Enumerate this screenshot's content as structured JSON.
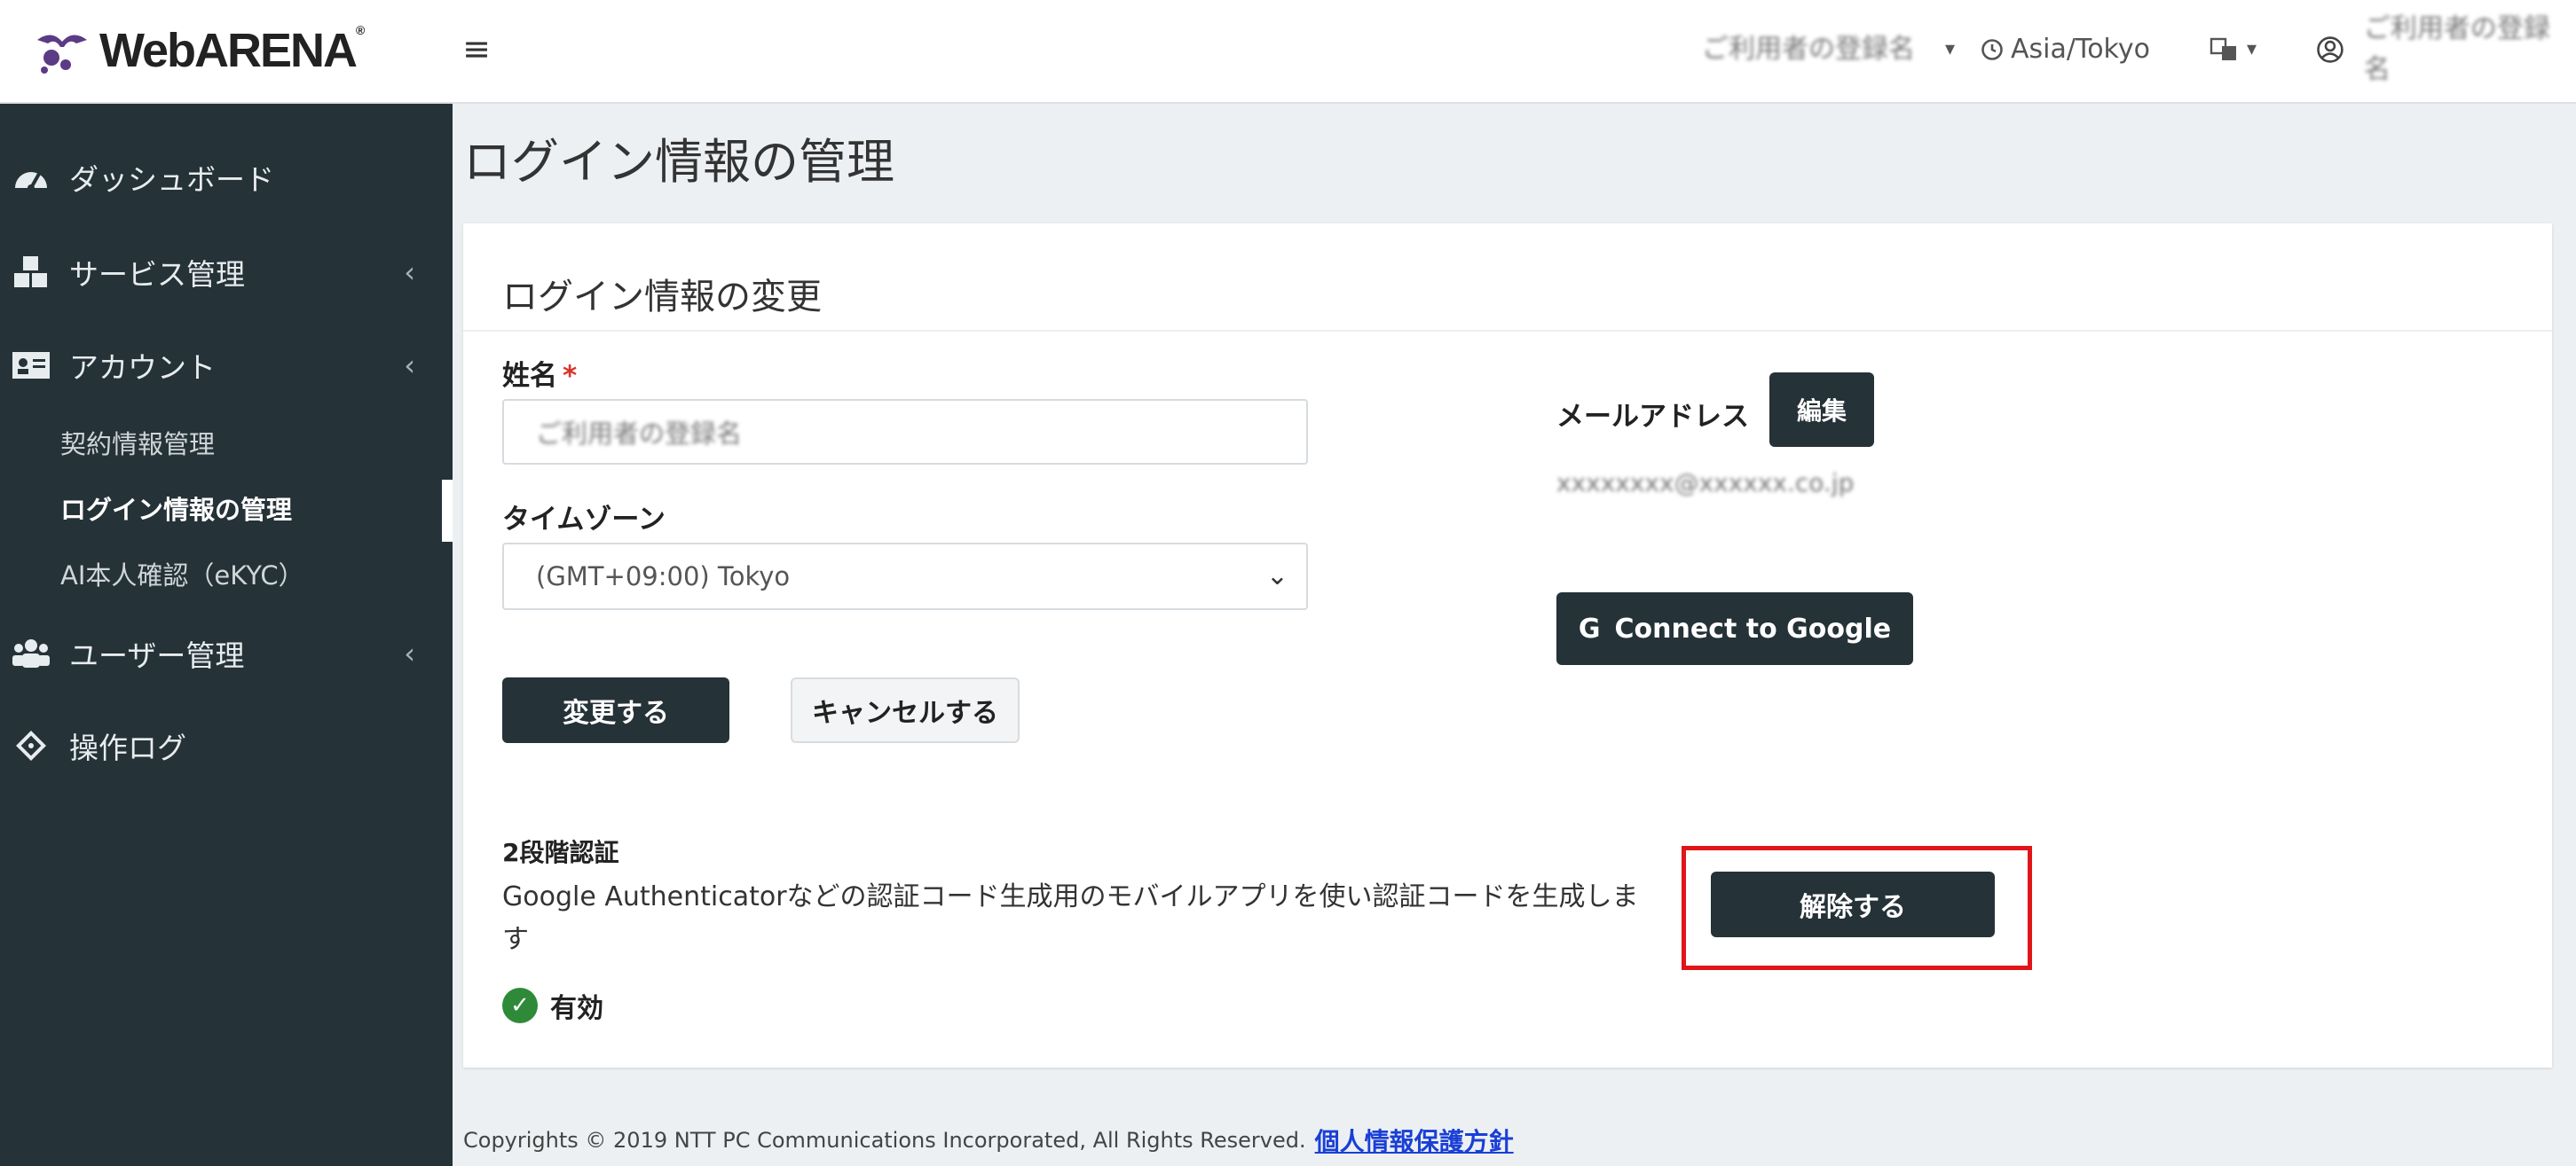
{
  "app": {
    "logo_text": "WebARENA",
    "logo_reg": "®"
  },
  "topbar": {
    "menu_glyph": "≡",
    "account_name": "ご利用者の登録名",
    "account_caret": "▾",
    "timezone": "Asia/Tokyo",
    "lang_caret": "▾",
    "user_name": "ご利用者の登録名"
  },
  "sidebar": {
    "items": [
      {
        "label": "ダッシュボード"
      },
      {
        "label": "サービス管理",
        "chevron": "‹"
      },
      {
        "label": "アカウント",
        "chevron": "‹"
      },
      {
        "label": "ユーザー管理",
        "chevron": "‹"
      },
      {
        "label": "操作ログ"
      }
    ],
    "sub_items": [
      {
        "label": "契約情報管理"
      },
      {
        "label": "ログイン情報の管理"
      },
      {
        "label": "AI本人確認（eKYC）"
      }
    ]
  },
  "page": {
    "title": "ログイン情報の管理"
  },
  "card": {
    "title": "ログイン情報の変更"
  },
  "form": {
    "name_label": "姓名",
    "required_mark": "*",
    "name_value": "ご利用者の登録名",
    "timezone_label": "タイムゾーン",
    "timezone_value": "(GMT+09:00) Tokyo",
    "timezone_caret": "⌄",
    "submit_label": "変更する",
    "cancel_label": "キャンセルする"
  },
  "email": {
    "label": "メールアドレス",
    "edit_label": "編集",
    "value": "xxxxxxxx@xxxxxx.co.jp"
  },
  "google": {
    "icon_glyph": "G",
    "label": "Connect to Google"
  },
  "twofa": {
    "title": "2段階認証",
    "description": "Google Authenticatorなどの認証コード生成用のモバイルアプリを使い認証コードを生成します",
    "check_glyph": "✓",
    "status": "有効",
    "disable_label": "解除する"
  },
  "footer": {
    "copyright": "Copyrights © 2019 NTT PC Communications Incorporated, All Rights Reserved.",
    "privacy_link": "個人情報保護方針"
  },
  "colors": {
    "sidebar_bg": "#253238",
    "button_dark": "#253238",
    "highlight": "#e0151a",
    "status_ok": "#2e8a38",
    "link": "#1a3fd6"
  }
}
